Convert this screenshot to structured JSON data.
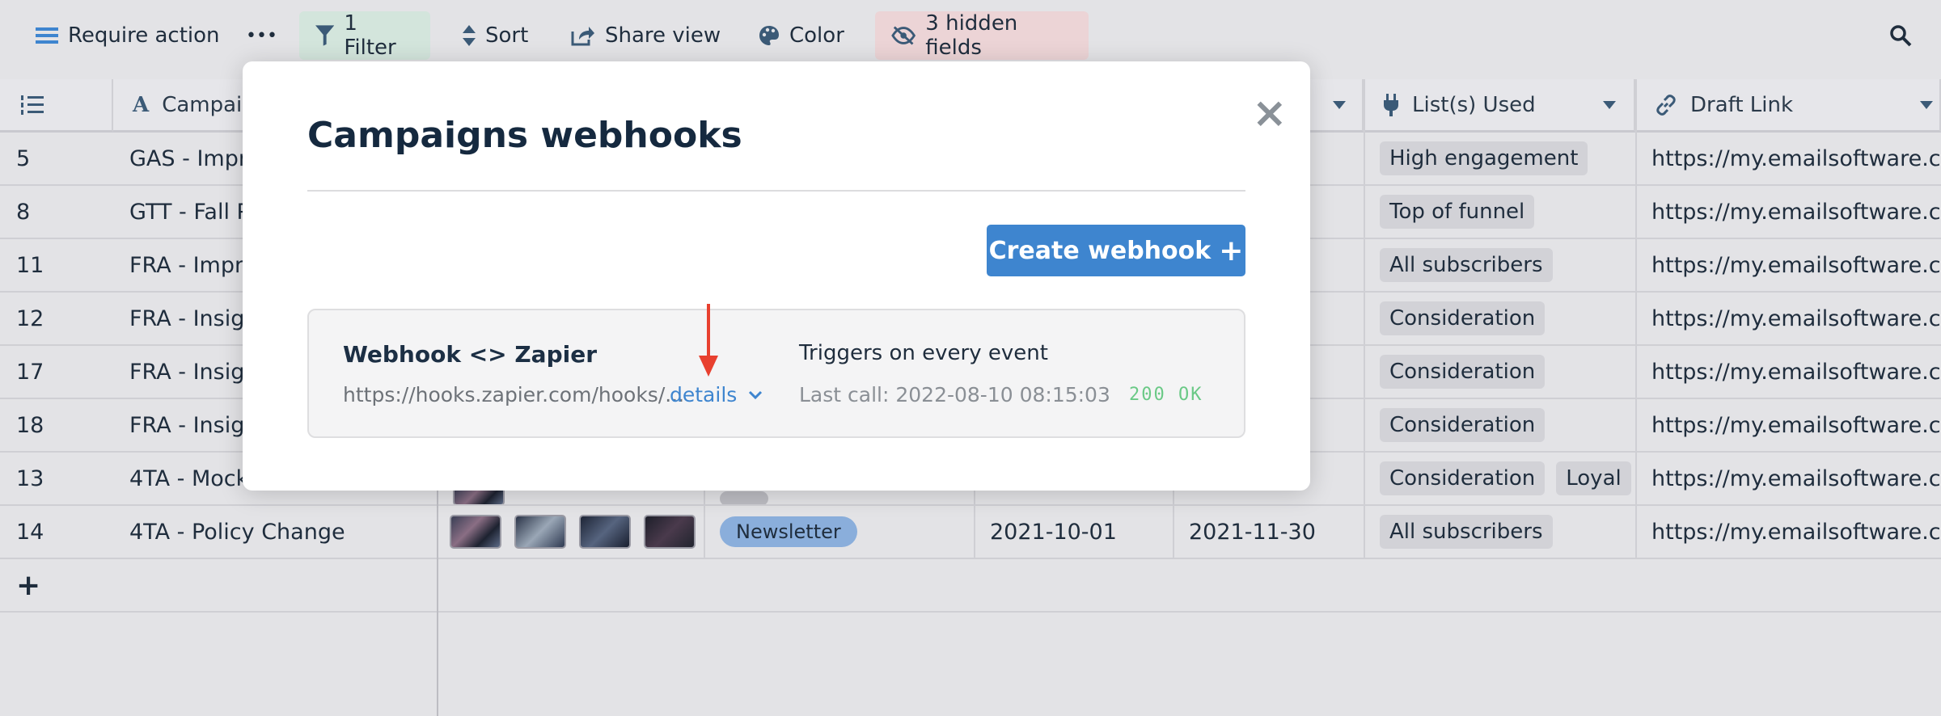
{
  "toolbar": {
    "view_name": "Require action",
    "more": "•••",
    "filter": "1 Filter",
    "sort": "Sort",
    "share": "Share view",
    "color": "Color",
    "hidden": "3 hidden fields",
    "colors": {
      "filter_bg": "#d3e5dc",
      "hidden_bg": "#ecd4d6"
    }
  },
  "grid": {
    "headers": {
      "campaign": "Campaign",
      "lists": "List(s) Used",
      "draft": "Draft Link"
    },
    "rows": [
      {
        "id": "5",
        "name": "GAS - Impro",
        "lists": [
          "High engagement"
        ],
        "link": "https://my.emailsoftware.c..."
      },
      {
        "id": "8",
        "name": "GTT - Fall Pr",
        "lists": [
          "Top of funnel"
        ],
        "link": "https://my.emailsoftware.c..."
      },
      {
        "id": "11",
        "name": "FRA - Impro",
        "lists": [
          "All subscribers"
        ],
        "link": "https://my.emailsoftware.c..."
      },
      {
        "id": "12",
        "name": "FRA - Insigh",
        "lists": [
          "Consideration"
        ],
        "link": "https://my.emailsoftware.c..."
      },
      {
        "id": "17",
        "name": "FRA - Insigh",
        "lists": [
          "Consideration"
        ],
        "link": "https://my.emailsoftware.c..."
      },
      {
        "id": "18",
        "name": "FRA - Insigh",
        "lists": [
          "Consideration"
        ],
        "link": "https://my.emailsoftware.c..."
      },
      {
        "id": "13",
        "name": "4TA - Mocku",
        "lists": [
          "Consideration",
          "Loyal"
        ],
        "link": "https://my.emailsoftware.c..."
      },
      {
        "id": "14",
        "name": "4TA - Policy Change",
        "type": "Newsletter",
        "start": "2021-10-01",
        "end": "2021-11-30",
        "lists": [
          "All subscribers"
        ],
        "link": "https://my.emailsoftware.c..."
      }
    ],
    "add_row": "+"
  },
  "modal": {
    "title": "Campaigns webhooks",
    "close": "×",
    "create_button": "Create webhook",
    "create_icon": "+",
    "webhook": {
      "name": "Webhook <> Zapier",
      "url": "https://hooks.zapier.com/hooks/...",
      "details_label": "details",
      "trigger": "Triggers on every event",
      "last_call": "Last call: 2022-08-10 08:15:03",
      "status": "200 OK"
    }
  },
  "annotation": {
    "arrow_color": "#e8402f"
  }
}
